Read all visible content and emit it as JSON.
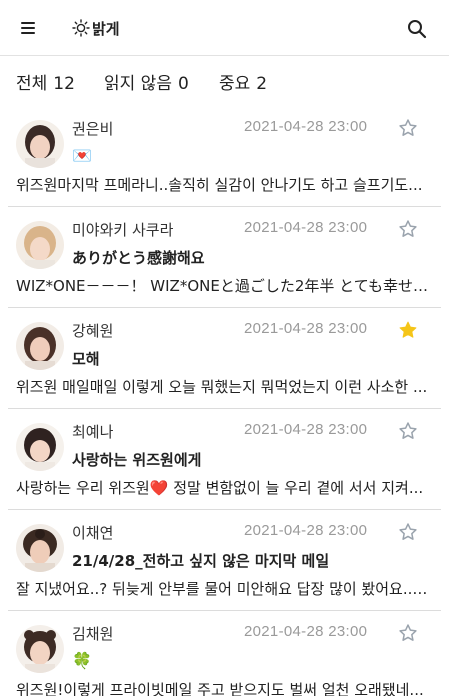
{
  "header": {
    "theme_label": "밝게",
    "menu_icon": "hamburger-menu-icon",
    "theme_icon": "sun-icon",
    "search_icon": "search-icon"
  },
  "filters": [
    {
      "label": "전체",
      "count": "12"
    },
    {
      "label": "읽지 않음",
      "count": "0"
    },
    {
      "label": "중요",
      "count": "2"
    }
  ],
  "colors": {
    "star_active": "#f5c518",
    "star_inactive": "#9aa3ad",
    "time": "#9a9a9a",
    "divider": "#dcdcdc"
  },
  "mails": [
    {
      "name": "권은비",
      "time": "2021-04-28 23:00",
      "starred": false,
      "subject": "💌",
      "preview": "위즈원마지막 프메라니..솔직히 실감이 안나기도 하고 슬프기도..."
    },
    {
      "name": "미야와키 사쿠라",
      "time": "2021-04-28 23:00",
      "starred": false,
      "subject": "ありがとう感謝해요",
      "preview": "WIZ*ONE－－－！ WIZ*ONEと過ごした2年半 とても幸せな..."
    },
    {
      "name": "강혜원",
      "time": "2021-04-28 23:00",
      "starred": true,
      "subject": "모해",
      "preview": "위즈원 매일매일 이렇게 오늘 뭐했는지 뭐먹었는지 이런 사소한 ..."
    },
    {
      "name": "최예나",
      "time": "2021-04-28 23:00",
      "starred": false,
      "subject": "사랑하는 위즈원에게",
      "preview_before": "사랑하는 우리 위즈원",
      "preview_heart": "❤️",
      "preview_after": " 정말 변함없이 늘 우리 곁에 서서 지켜..."
    },
    {
      "name": "이채연",
      "time": "2021-04-28 23:00",
      "starred": false,
      "subject": "21/4/28_전하고 싶지 않은 마지막 메일",
      "preview": "잘 지냈어요..? 뒤늦게 안부를 물어 미안해요 답장 많이 봤어요.. ..."
    },
    {
      "name": "김채원",
      "time": "2021-04-28 23:00",
      "starred": false,
      "subject": "🍀",
      "preview": "위즈원!이렇게 프라이빗메일 주고 받으지도 벌써 얼천 오래됐네..."
    }
  ]
}
